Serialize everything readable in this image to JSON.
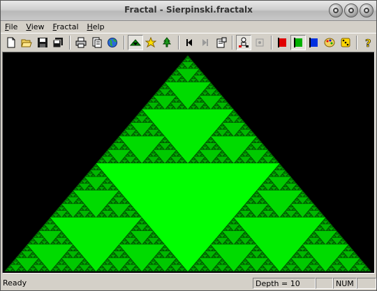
{
  "window": {
    "title": "Fractal - Sierpinski.fractalx"
  },
  "menu": [
    "File",
    "View",
    "Fractal",
    "Help"
  ],
  "menu_underline": [
    "F",
    "V",
    "F",
    "H"
  ],
  "toolbar": {
    "buttons": [
      "new-document",
      "open-folder",
      "save-disk",
      "save-all-disks",
      "print",
      "print-preview",
      "globe",
      "triangle-fractal",
      "star-fractal",
      "tree-fractal",
      "step-back",
      "step-forward",
      "properties",
      "network",
      "disabled-item",
      "red-flag",
      "green-flag",
      "blue-flag",
      "palette",
      "dice",
      "help"
    ],
    "pressed": [
      "triangle-fractal",
      "green-flag"
    ]
  },
  "fractal": {
    "type": "sierpinski",
    "depth": 10,
    "color": "#00e000"
  },
  "status": {
    "text": "Ready",
    "depth": "Depth = 10",
    "num": "NUM"
  }
}
